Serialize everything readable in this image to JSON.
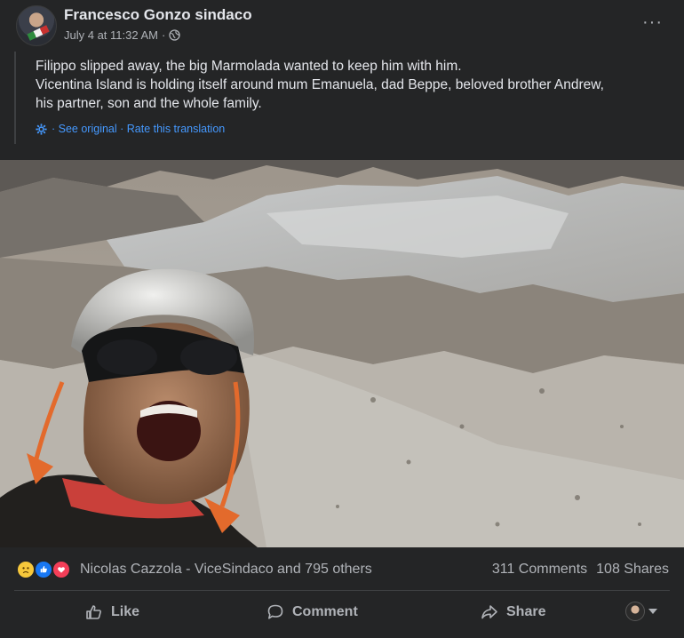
{
  "post": {
    "author": "Francesco Gonzo sindaco",
    "date": "July 4 at 11:32 AM",
    "separator": "·",
    "more_label": "···",
    "text_line1": "Filippo slipped away, the big Marmolada wanted to keep him with him.",
    "text_line2": "Vicentina Island is holding itself around mum Emanuela, dad Beppe, beloved brother Andrew,",
    "text_line3": "his partner, son and the whole family.",
    "translation_links": "· See original · Rate this translation"
  },
  "reactions": {
    "icons": [
      "sad-reaction-icon",
      "like-reaction-icon",
      "love-reaction-icon"
    ],
    "names": "Nicolas Cazzola - ViceSindaco and 795 others",
    "comments": "311 Comments",
    "shares": "108 Shares"
  },
  "actions": {
    "like": "Like",
    "comment": "Comment",
    "share": "Share"
  },
  "colors": {
    "background": "#242526",
    "text": "#e4e6eb",
    "secondary": "#b0b3b8",
    "link": "#4599ff"
  }
}
